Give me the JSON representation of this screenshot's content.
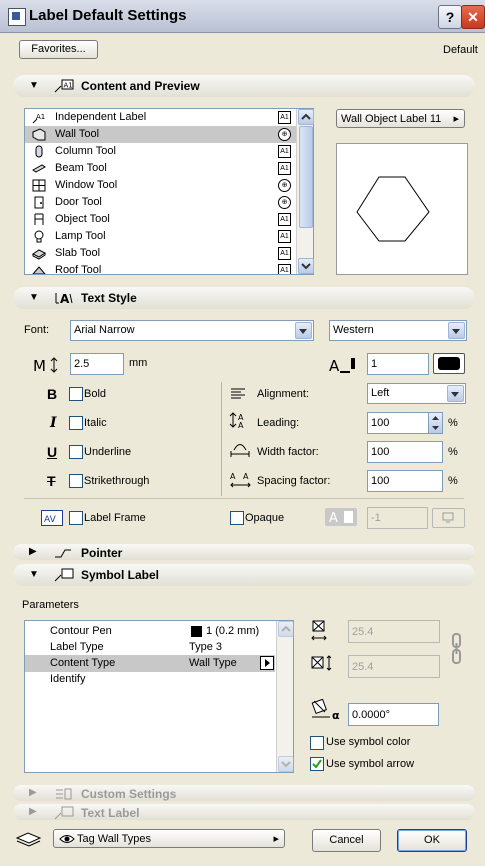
{
  "window": {
    "title": "Label Default Settings",
    "help": "?",
    "close": "✕"
  },
  "favorites": {
    "button": "Favorites...",
    "status": "Default"
  },
  "content": {
    "header": "Content and Preview",
    "icon_text": "A1",
    "items": [
      {
        "label": "Independent Label",
        "badge": "A1",
        "icon_text": "A1"
      },
      {
        "label": "Wall Tool",
        "badge": "⊕"
      },
      {
        "label": "Column Tool",
        "badge": "A1"
      },
      {
        "label": "Beam Tool",
        "badge": "A1"
      },
      {
        "label": "Window Tool",
        "badge": "⊕"
      },
      {
        "label": "Door Tool",
        "badge": "⊕"
      },
      {
        "label": "Object Tool",
        "badge": "A1"
      },
      {
        "label": "Lamp Tool",
        "badge": "A1"
      },
      {
        "label": "Slab Tool",
        "badge": "A1"
      },
      {
        "label": "Roof Tool",
        "badge": "A1"
      }
    ],
    "selected_index": 1,
    "preview_button": "Wall Object Label 11"
  },
  "text_style": {
    "header": "Text Style",
    "font_label": "Font:",
    "font_value": "Arial Narrow",
    "script_value": "Western",
    "size_value": "2.5",
    "size_unit": "mm",
    "pen_value": "1",
    "bold": "Bold",
    "italic": "Italic",
    "underline": "Underline",
    "strikethrough": "Strikethrough",
    "alignment_label": "Alignment:",
    "alignment_value": "Left",
    "leading_label": "Leading:",
    "leading_value": "100",
    "width_label": "Width factor:",
    "width_value": "100",
    "spacing_label": "Spacing factor:",
    "spacing_value": "100",
    "percent": "%",
    "label_frame": "Label Frame",
    "opaque": "Opaque",
    "fill_pen": "-1"
  },
  "pointer": {
    "header": "Pointer"
  },
  "symbol": {
    "header": "Symbol Label",
    "params_label": "Parameters",
    "params": [
      {
        "name": "Contour Pen",
        "value": "1 (0.2 mm)"
      },
      {
        "name": "Label Type",
        "value": "Type 3"
      },
      {
        "name": "Content Type",
        "value": "Wall Type"
      },
      {
        "name": "Identify",
        "value": ""
      }
    ],
    "selected_param": 2,
    "width_value": "25.4",
    "height_value": "25.4",
    "angle_value": "0.0000°",
    "use_symbol_color": "Use symbol color",
    "use_symbol_arrow": "Use symbol arrow",
    "use_symbol_arrow_checked": true
  },
  "custom": {
    "header": "Custom Settings"
  },
  "text_label": {
    "header": "Text Label"
  },
  "footer": {
    "layer": "Tag Wall Types",
    "cancel": "Cancel",
    "ok": "OK"
  }
}
